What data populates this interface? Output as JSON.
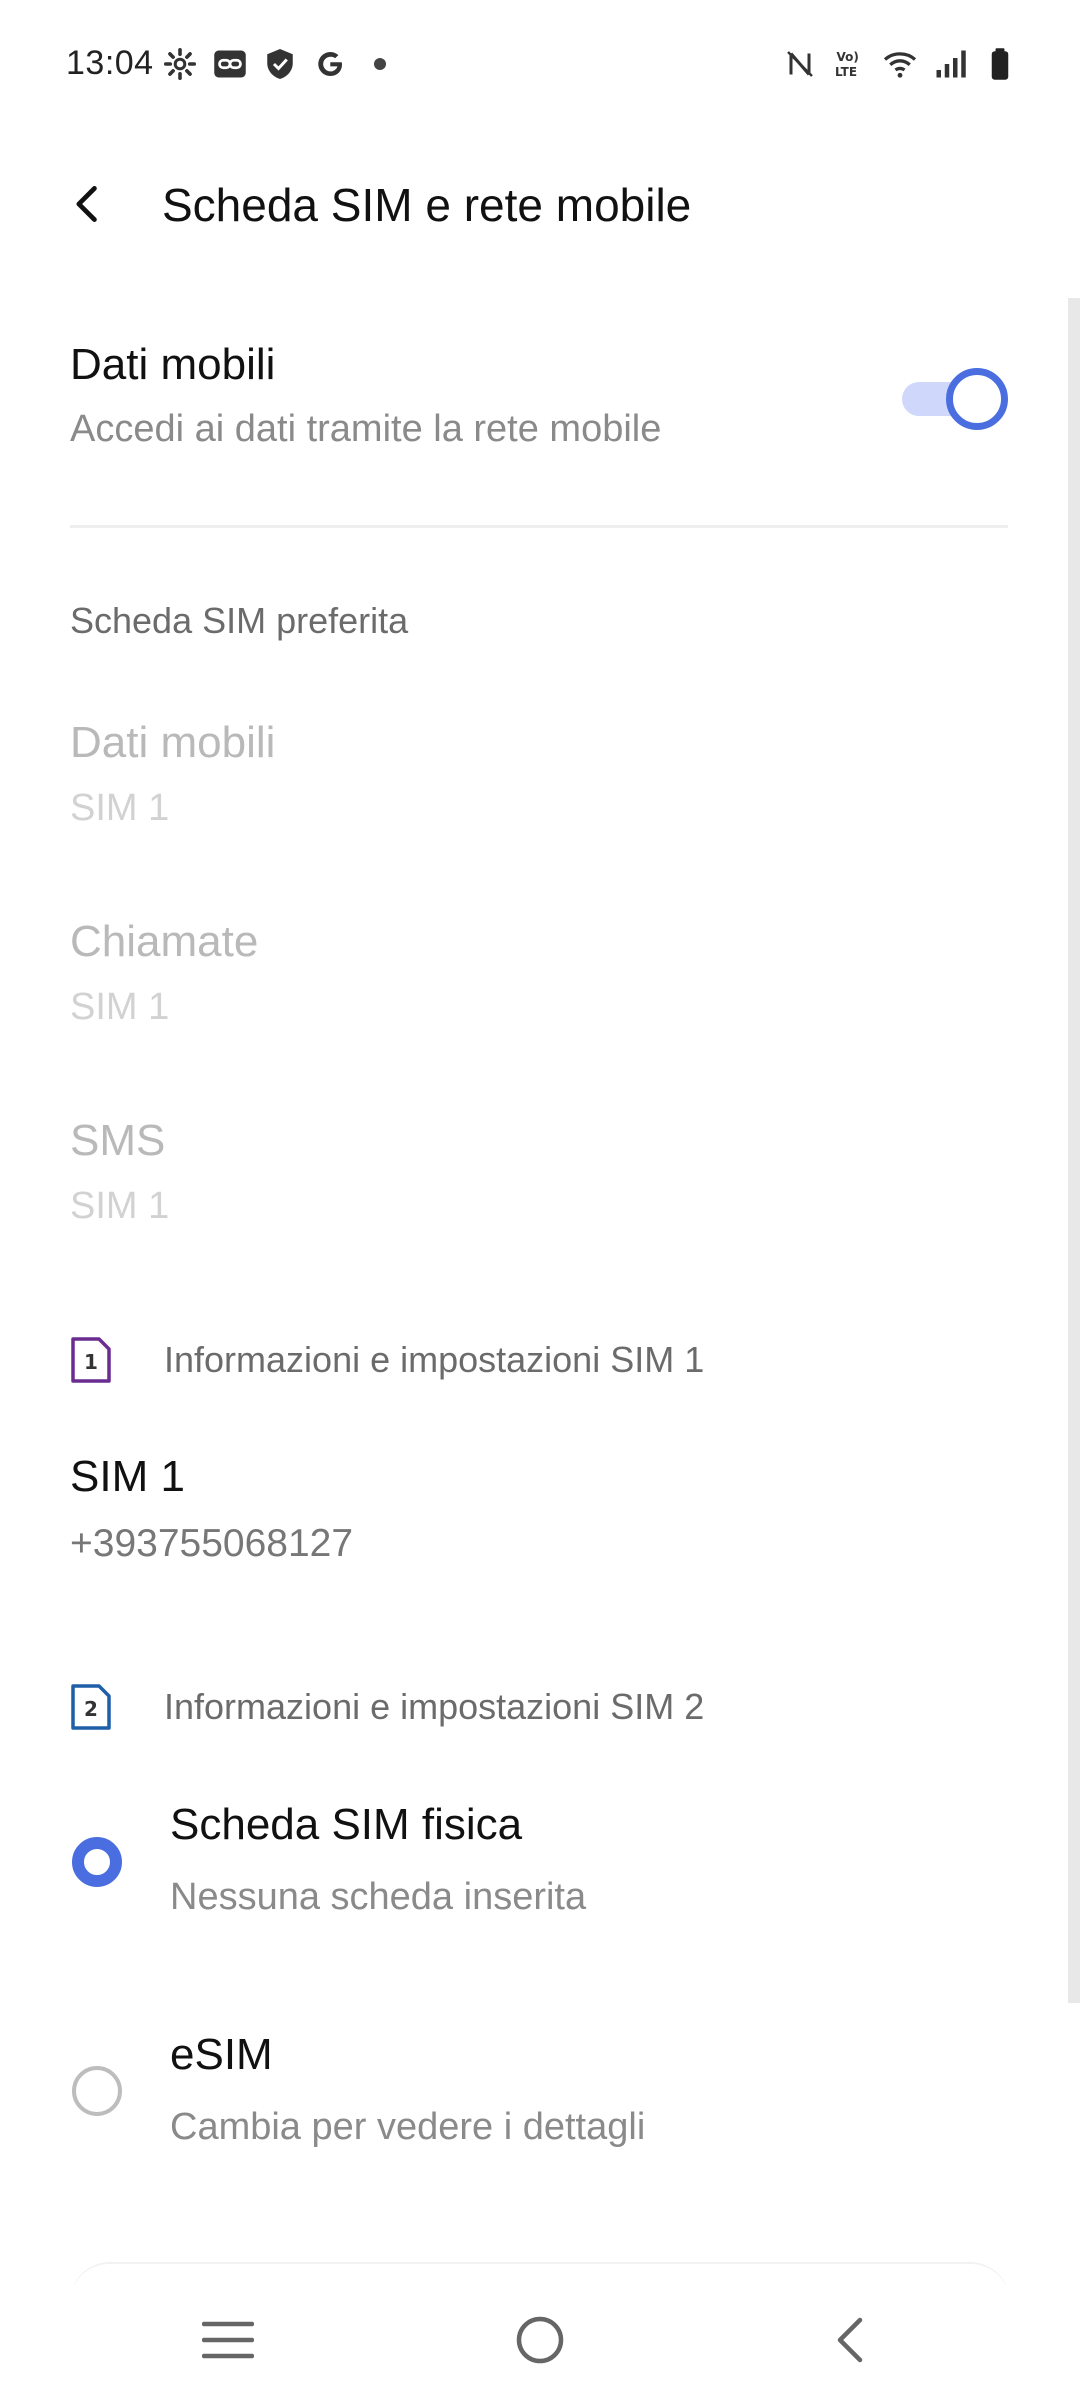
{
  "status_bar": {
    "time": "13:04",
    "left_icons": [
      "settings-icon",
      "link-icon",
      "shield-icon",
      "google-icon",
      "dot-icon"
    ],
    "right_icons": [
      "nfc-icon",
      "volte-icon",
      "wifi-icon",
      "signal-icon",
      "battery-icon"
    ]
  },
  "header": {
    "title": "Scheda SIM e rete mobile",
    "back_icon": "back-arrow-icon"
  },
  "mobile_data": {
    "title": "Dati mobili",
    "subtitle": "Accedi ai dati tramite la rete mobile",
    "enabled": true,
    "accent": "#4a6ee0"
  },
  "preferred_sim": {
    "label": "Scheda SIM preferita",
    "items": [
      {
        "title": "Dati mobili",
        "value": "SIM 1"
      },
      {
        "title": "Chiamate",
        "value": "SIM 1"
      },
      {
        "title": "SMS",
        "value": "SIM 1"
      }
    ]
  },
  "sim1": {
    "section_label": "Informazioni e impostazioni SIM 1",
    "badge": "1",
    "badge_color": "#6a2c91",
    "name": "SIM 1",
    "number": "+393755068127"
  },
  "sim2": {
    "section_label": "Informazioni e impostazioni SIM 2",
    "badge": "2",
    "badge_color": "#1f5fa8",
    "options": [
      {
        "title": "Scheda SIM fisica",
        "subtitle": "Nessuna scheda inserita",
        "selected": true
      },
      {
        "title": "eSIM",
        "subtitle": "Cambia per vedere i dettagli",
        "selected": false
      }
    ]
  },
  "nav_bar": {
    "buttons": [
      "menu-icon",
      "home-icon",
      "back-icon"
    ]
  }
}
